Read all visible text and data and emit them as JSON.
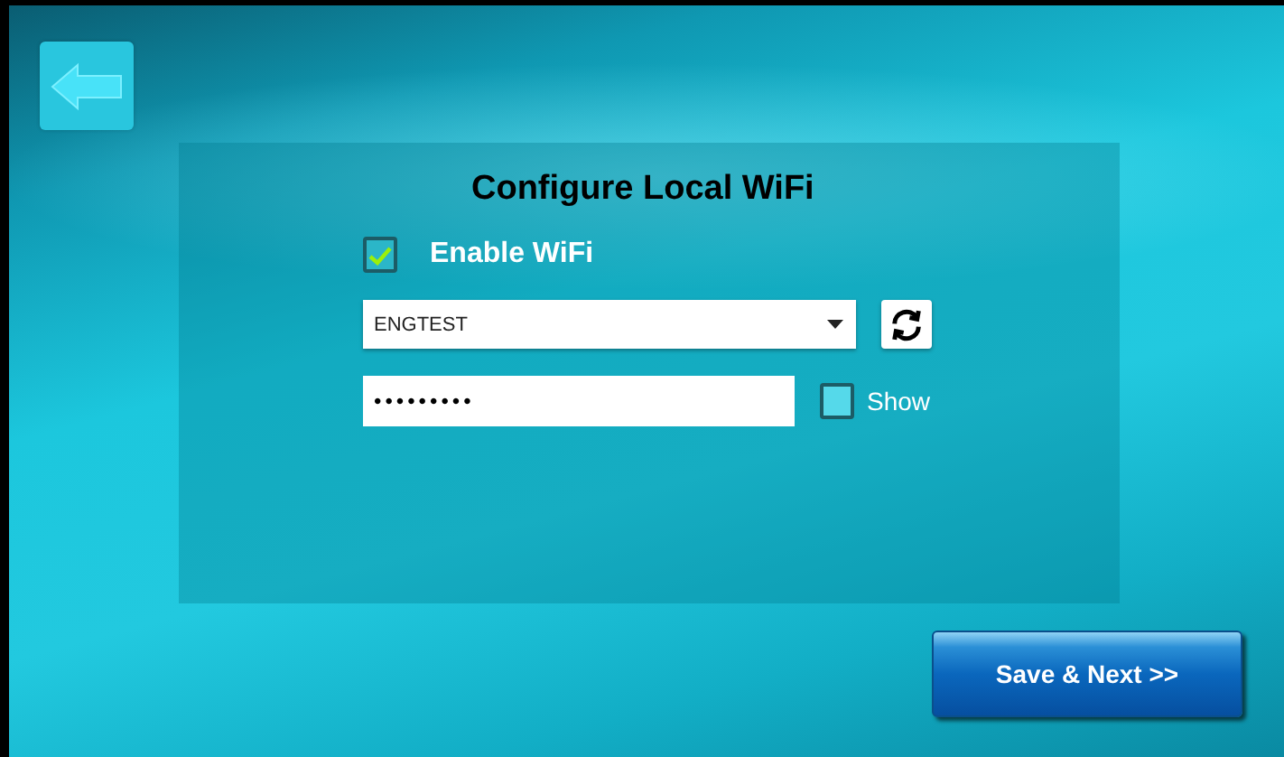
{
  "title": "Configure Local WiFi",
  "enable_wifi": {
    "label": "Enable WiFi",
    "checked": true
  },
  "network": {
    "value": "ENGTEST"
  },
  "password": {
    "value": "•••••••••"
  },
  "show_password": {
    "label": "Show",
    "checked": false
  },
  "save_button": {
    "label": "Save & Next >>"
  }
}
